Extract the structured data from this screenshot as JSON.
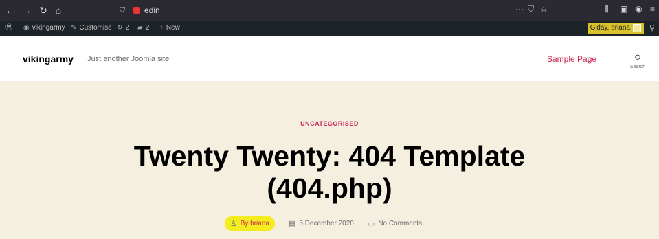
{
  "browser": {
    "url": "edin",
    "icons": {
      "back": "back-arrow-icon",
      "forward": "forward-arrow-icon",
      "reload": "reload-icon",
      "home": "home-icon",
      "tracking": "shield-icon",
      "more": "more-icon",
      "pocket": "pocket-icon",
      "bookmark": "star-icon",
      "library": "library-icon",
      "sidebar": "sidebar-icon",
      "account": "account-icon",
      "menu": "hamburger-menu-icon"
    }
  },
  "admin_bar": {
    "site_name": "vikingarmy",
    "customise": "Customise",
    "updates_count": "2",
    "comments_count": "2",
    "new_label": "New",
    "greeting": "G'day, briana",
    "highlight_color": "#d9c22a"
  },
  "header": {
    "site_title": "vikingarmy",
    "tagline": "Just another Joomla site",
    "menu": [
      "Sample Page"
    ],
    "search_label": "Search",
    "accent_color": "#cd2653"
  },
  "post": {
    "category": "UNCATEGORISED",
    "title_line1": "Twenty Twenty: 404 Template",
    "title_line2": "(404.php)",
    "author": "By briana",
    "date": "5 December 2020",
    "comments": "No Comments",
    "background_color": "#f5efe0",
    "author_highlight": "#f3ec1f"
  }
}
